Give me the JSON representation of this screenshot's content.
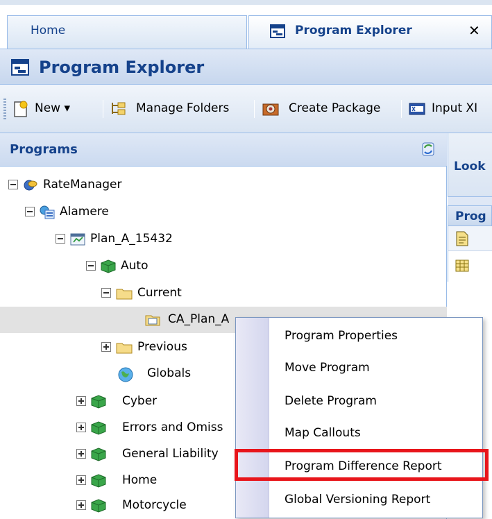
{
  "tabs": {
    "home_label": "Home",
    "explorer_label": "Program Explorer",
    "close_glyph": "✕"
  },
  "panel": {
    "title": "Program Explorer"
  },
  "toolbar": {
    "new_label": "New ▾",
    "manage_folders_label": "Manage Folders",
    "create_package_label": "Create Package",
    "input_xml_label": "Input XI"
  },
  "programs": {
    "header": "Programs",
    "tree": [
      {
        "label": "RateManager",
        "icon": "ratemanager-icon"
      },
      {
        "label": "Alamere",
        "icon": "company-icon"
      },
      {
        "label": "Plan_A_15432",
        "icon": "plan-icon"
      },
      {
        "label": "Auto",
        "icon": "cube-icon"
      },
      {
        "label": "Current",
        "icon": "folder-icon"
      },
      {
        "label": "CA_Plan_A​",
        "icon": "program-icon"
      },
      {
        "label": "Previous",
        "icon": "folder-icon"
      },
      {
        "label": "Globals",
        "icon": "globe-icon"
      },
      {
        "label": "Cyber",
        "icon": "cube-icon"
      },
      {
        "label": "Errors and Omiss",
        "icon": "cube-icon"
      },
      {
        "label": "General Liability",
        "icon": "cube-icon"
      },
      {
        "label": "Home",
        "icon": "cube-icon"
      },
      {
        "label": "Motorcycle",
        "icon": "cube-icon"
      }
    ]
  },
  "right_panel": {
    "look_label": "Look",
    "prog_label": "Prog"
  },
  "context_menu": {
    "items": [
      "Program Properties",
      "Move Program",
      "Delete Program",
      "Map Callouts",
      "Program Difference Report",
      "Global Versioning Report"
    ],
    "highlighted_index": 4,
    "highlight_color": "#e8151b"
  },
  "colors": {
    "header_text": "#15428b",
    "border": "#99bbe8"
  }
}
